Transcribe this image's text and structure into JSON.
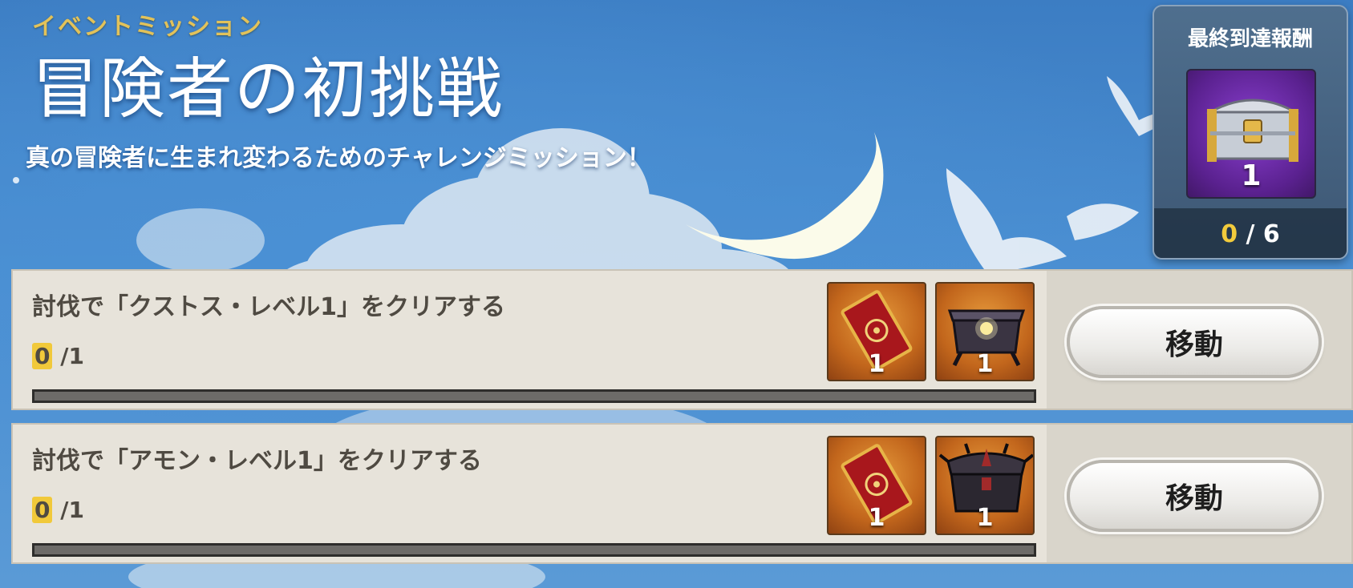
{
  "header": {
    "event_tag": "イベントミッション",
    "title": "冒険者の初挑戦",
    "description": "真の冒険者に生まれ変わるためのチャレンジミッション！"
  },
  "final_reward": {
    "title": "最終到達報酬",
    "item_icon": "silver-chest-icon",
    "item_quantity": "1",
    "progress_current": "0",
    "progress_total": "/ 6"
  },
  "missions": [
    {
      "text": "討伐で「クストス・レベル1」をクリアする",
      "progress_current": "0",
      "progress_total": "/1",
      "progress_fraction": 0,
      "rewards": [
        {
          "icon": "red-card-icon",
          "quantity": "1"
        },
        {
          "icon": "dark-chest-icon",
          "quantity": "1"
        }
      ],
      "button_label": "移動"
    },
    {
      "text": "討伐で「アモン・レベル1」をクリアする",
      "progress_current": "0",
      "progress_total": "/1",
      "progress_fraction": 0,
      "rewards": [
        {
          "icon": "red-card-icon",
          "quantity": "1"
        },
        {
          "icon": "spiked-chest-icon",
          "quantity": "1"
        }
      ],
      "button_label": "移動"
    }
  ]
}
